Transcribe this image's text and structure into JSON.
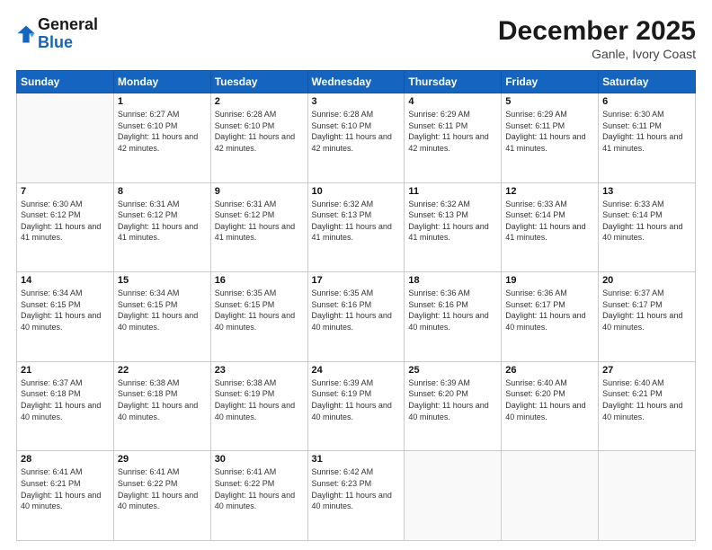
{
  "header": {
    "logo_line1": "General",
    "logo_line2": "Blue",
    "month": "December 2025",
    "location": "Ganle, Ivory Coast"
  },
  "days_of_week": [
    "Sunday",
    "Monday",
    "Tuesday",
    "Wednesday",
    "Thursday",
    "Friday",
    "Saturday"
  ],
  "weeks": [
    [
      {
        "day": null,
        "info": null
      },
      {
        "day": "1",
        "sunrise": "6:27 AM",
        "sunset": "6:10 PM",
        "daylight": "11 hours and 42 minutes."
      },
      {
        "day": "2",
        "sunrise": "6:28 AM",
        "sunset": "6:10 PM",
        "daylight": "11 hours and 42 minutes."
      },
      {
        "day": "3",
        "sunrise": "6:28 AM",
        "sunset": "6:10 PM",
        "daylight": "11 hours and 42 minutes."
      },
      {
        "day": "4",
        "sunrise": "6:29 AM",
        "sunset": "6:11 PM",
        "daylight": "11 hours and 42 minutes."
      },
      {
        "day": "5",
        "sunrise": "6:29 AM",
        "sunset": "6:11 PM",
        "daylight": "11 hours and 41 minutes."
      },
      {
        "day": "6",
        "sunrise": "6:30 AM",
        "sunset": "6:11 PM",
        "daylight": "11 hours and 41 minutes."
      }
    ],
    [
      {
        "day": "7",
        "sunrise": "6:30 AM",
        "sunset": "6:12 PM",
        "daylight": "11 hours and 41 minutes."
      },
      {
        "day": "8",
        "sunrise": "6:31 AM",
        "sunset": "6:12 PM",
        "daylight": "11 hours and 41 minutes."
      },
      {
        "day": "9",
        "sunrise": "6:31 AM",
        "sunset": "6:12 PM",
        "daylight": "11 hours and 41 minutes."
      },
      {
        "day": "10",
        "sunrise": "6:32 AM",
        "sunset": "6:13 PM",
        "daylight": "11 hours and 41 minutes."
      },
      {
        "day": "11",
        "sunrise": "6:32 AM",
        "sunset": "6:13 PM",
        "daylight": "11 hours and 41 minutes."
      },
      {
        "day": "12",
        "sunrise": "6:33 AM",
        "sunset": "6:14 PM",
        "daylight": "11 hours and 41 minutes."
      },
      {
        "day": "13",
        "sunrise": "6:33 AM",
        "sunset": "6:14 PM",
        "daylight": "11 hours and 40 minutes."
      }
    ],
    [
      {
        "day": "14",
        "sunrise": "6:34 AM",
        "sunset": "6:15 PM",
        "daylight": "11 hours and 40 minutes."
      },
      {
        "day": "15",
        "sunrise": "6:34 AM",
        "sunset": "6:15 PM",
        "daylight": "11 hours and 40 minutes."
      },
      {
        "day": "16",
        "sunrise": "6:35 AM",
        "sunset": "6:15 PM",
        "daylight": "11 hours and 40 minutes."
      },
      {
        "day": "17",
        "sunrise": "6:35 AM",
        "sunset": "6:16 PM",
        "daylight": "11 hours and 40 minutes."
      },
      {
        "day": "18",
        "sunrise": "6:36 AM",
        "sunset": "6:16 PM",
        "daylight": "11 hours and 40 minutes."
      },
      {
        "day": "19",
        "sunrise": "6:36 AM",
        "sunset": "6:17 PM",
        "daylight": "11 hours and 40 minutes."
      },
      {
        "day": "20",
        "sunrise": "6:37 AM",
        "sunset": "6:17 PM",
        "daylight": "11 hours and 40 minutes."
      }
    ],
    [
      {
        "day": "21",
        "sunrise": "6:37 AM",
        "sunset": "6:18 PM",
        "daylight": "11 hours and 40 minutes."
      },
      {
        "day": "22",
        "sunrise": "6:38 AM",
        "sunset": "6:18 PM",
        "daylight": "11 hours and 40 minutes."
      },
      {
        "day": "23",
        "sunrise": "6:38 AM",
        "sunset": "6:19 PM",
        "daylight": "11 hours and 40 minutes."
      },
      {
        "day": "24",
        "sunrise": "6:39 AM",
        "sunset": "6:19 PM",
        "daylight": "11 hours and 40 minutes."
      },
      {
        "day": "25",
        "sunrise": "6:39 AM",
        "sunset": "6:20 PM",
        "daylight": "11 hours and 40 minutes."
      },
      {
        "day": "26",
        "sunrise": "6:40 AM",
        "sunset": "6:20 PM",
        "daylight": "11 hours and 40 minutes."
      },
      {
        "day": "27",
        "sunrise": "6:40 AM",
        "sunset": "6:21 PM",
        "daylight": "11 hours and 40 minutes."
      }
    ],
    [
      {
        "day": "28",
        "sunrise": "6:41 AM",
        "sunset": "6:21 PM",
        "daylight": "11 hours and 40 minutes."
      },
      {
        "day": "29",
        "sunrise": "6:41 AM",
        "sunset": "6:22 PM",
        "daylight": "11 hours and 40 minutes."
      },
      {
        "day": "30",
        "sunrise": "6:41 AM",
        "sunset": "6:22 PM",
        "daylight": "11 hours and 40 minutes."
      },
      {
        "day": "31",
        "sunrise": "6:42 AM",
        "sunset": "6:23 PM",
        "daylight": "11 hours and 40 minutes."
      },
      {
        "day": null,
        "info": null
      },
      {
        "day": null,
        "info": null
      },
      {
        "day": null,
        "info": null
      }
    ]
  ]
}
